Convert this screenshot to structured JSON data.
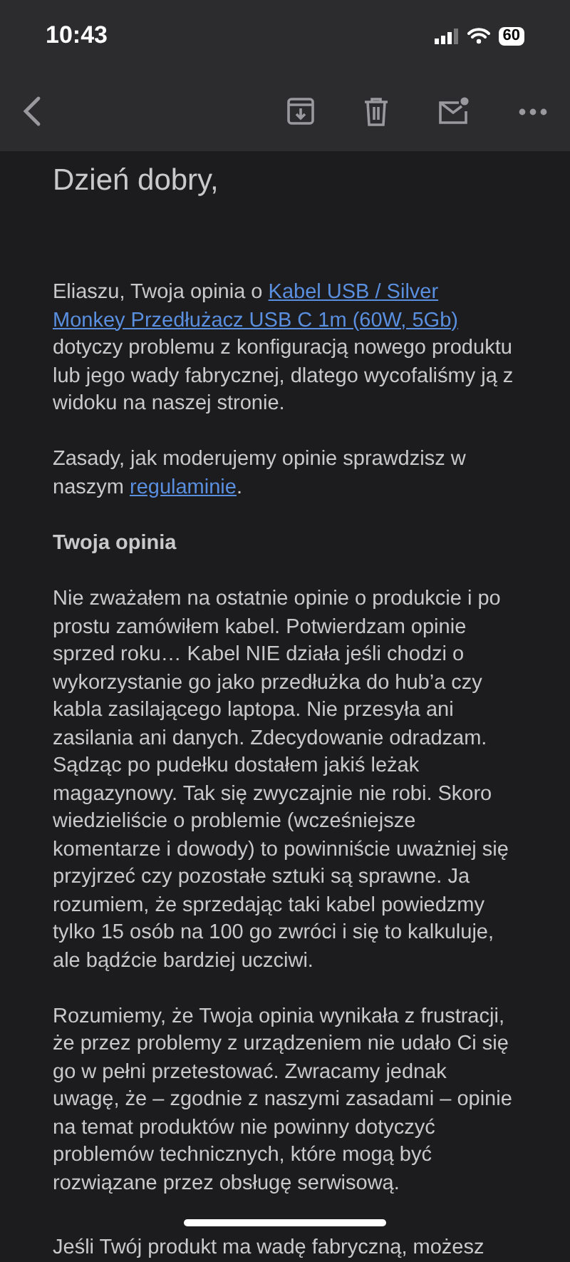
{
  "status_bar": {
    "time": "10:43",
    "battery": "60"
  },
  "email": {
    "greeting": "Dzień dobry,",
    "blocks": [
      {
        "kind": "paragraph",
        "segments": [
          {
            "kind": "text",
            "text": "Eliaszu, Twoja opinia o "
          },
          {
            "kind": "link",
            "text": "Kabel USB / Silver"
          },
          {
            "kind": "link",
            "text": "Monkey Przedłużacz USB C 1m (60W, 5Gb)"
          },
          {
            "kind": "text",
            "text": " dotyczy problemu z konfiguracją nowego produktu lub jego wady fabrycznej, dlatego wycofaliśmy ją z widoku na naszej stronie."
          }
        ]
      },
      {
        "kind": "paragraph",
        "segments": [
          {
            "kind": "text",
            "text": "Zasady, jak moderujemy opinie sprawdzisz w naszym "
          },
          {
            "kind": "link",
            "text": "regulaminie"
          },
          {
            "kind": "text",
            "text": "."
          }
        ]
      },
      {
        "kind": "heading",
        "segments": [
          {
            "kind": "text",
            "text": "Twoja opinia"
          }
        ]
      },
      {
        "kind": "paragraph",
        "segments": [
          {
            "kind": "text",
            "text": "Nie zważałem na ostatnie opinie o produkcie i po prostu zamówiłem kabel. Potwierdzam opinie sprzed roku… Kabel NIE działa jeśli chodzi o wykorzystanie go jako przedłużka do hub’a czy kabla zasilającego laptopa. Nie przesyła ani zasilania ani danych. Zdecydowanie odradzam. Sądząc po pudełku dostałem jakiś leżak magazynowy. Tak się zwyczajnie nie robi. Skoro wiedzieliście o problemie (wcześniejsze komentarze i dowody) to powinniście uważniej się przyjrzeć czy pozostałe sztuki są sprawne. Ja rozumiem, że sprzedając taki kabel powiedzmy tylko 15 osób na 100 go zwróci i się to kalkuluje, ale bądźcie bardziej uczciwi."
          }
        ]
      },
      {
        "kind": "paragraph",
        "segments": [
          {
            "kind": "text",
            "text": "Rozumiemy, że Twoja opinia wynikała z frustracji, że przez problemy z urządzeniem nie udało Ci się go w pełni przetestować. Zwracamy jednak uwagę, że – zgodnie z naszymi zasadami – opinie na temat produktów nie powinny dotyczyć problemów technicznych, które mogą być rozwiązane przez obsługę serwisową."
          }
        ]
      },
      {
        "kind": "last",
        "segments": [
          {
            "kind": "text",
            "text": "Jeśli Twój produkt ma wadę fabryczną, możesz"
          }
        ]
      }
    ]
  }
}
